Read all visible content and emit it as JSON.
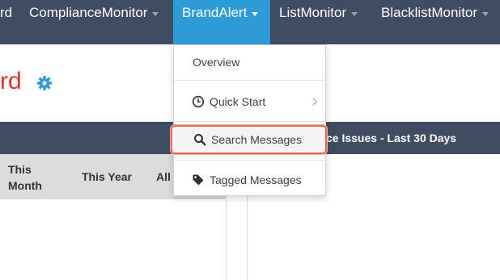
{
  "nav": {
    "items": [
      {
        "label": "rd"
      },
      {
        "label": "ComplianceMonitor"
      },
      {
        "label": "BrandAlert"
      },
      {
        "label": "ListMonitor"
      },
      {
        "label": "BlacklistMonitor"
      }
    ]
  },
  "page": {
    "title": "rd"
  },
  "section": {
    "right_title": "ce Issues - Last 30 Days"
  },
  "table": {
    "columns": [
      {
        "label_line1": "This",
        "label_line2": "Month"
      },
      {
        "label": "This Year"
      },
      {
        "label": "All"
      }
    ]
  },
  "dropdown": {
    "items": [
      {
        "label": "Overview",
        "icon": ""
      },
      {
        "label": "Quick Start",
        "icon": "clock-icon",
        "has_submenu": true
      },
      {
        "label": "Search Messages",
        "icon": "search-icon",
        "highlighted": true
      },
      {
        "label": "Tagged Messages",
        "icon": "tag-icon"
      }
    ]
  },
  "colors": {
    "nav_bg": "#3f4c61",
    "nav_active": "#2f9bd6",
    "title_red": "#d9342b",
    "gear_blue": "#2f9bd6",
    "highlight_border": "#e8664f"
  }
}
